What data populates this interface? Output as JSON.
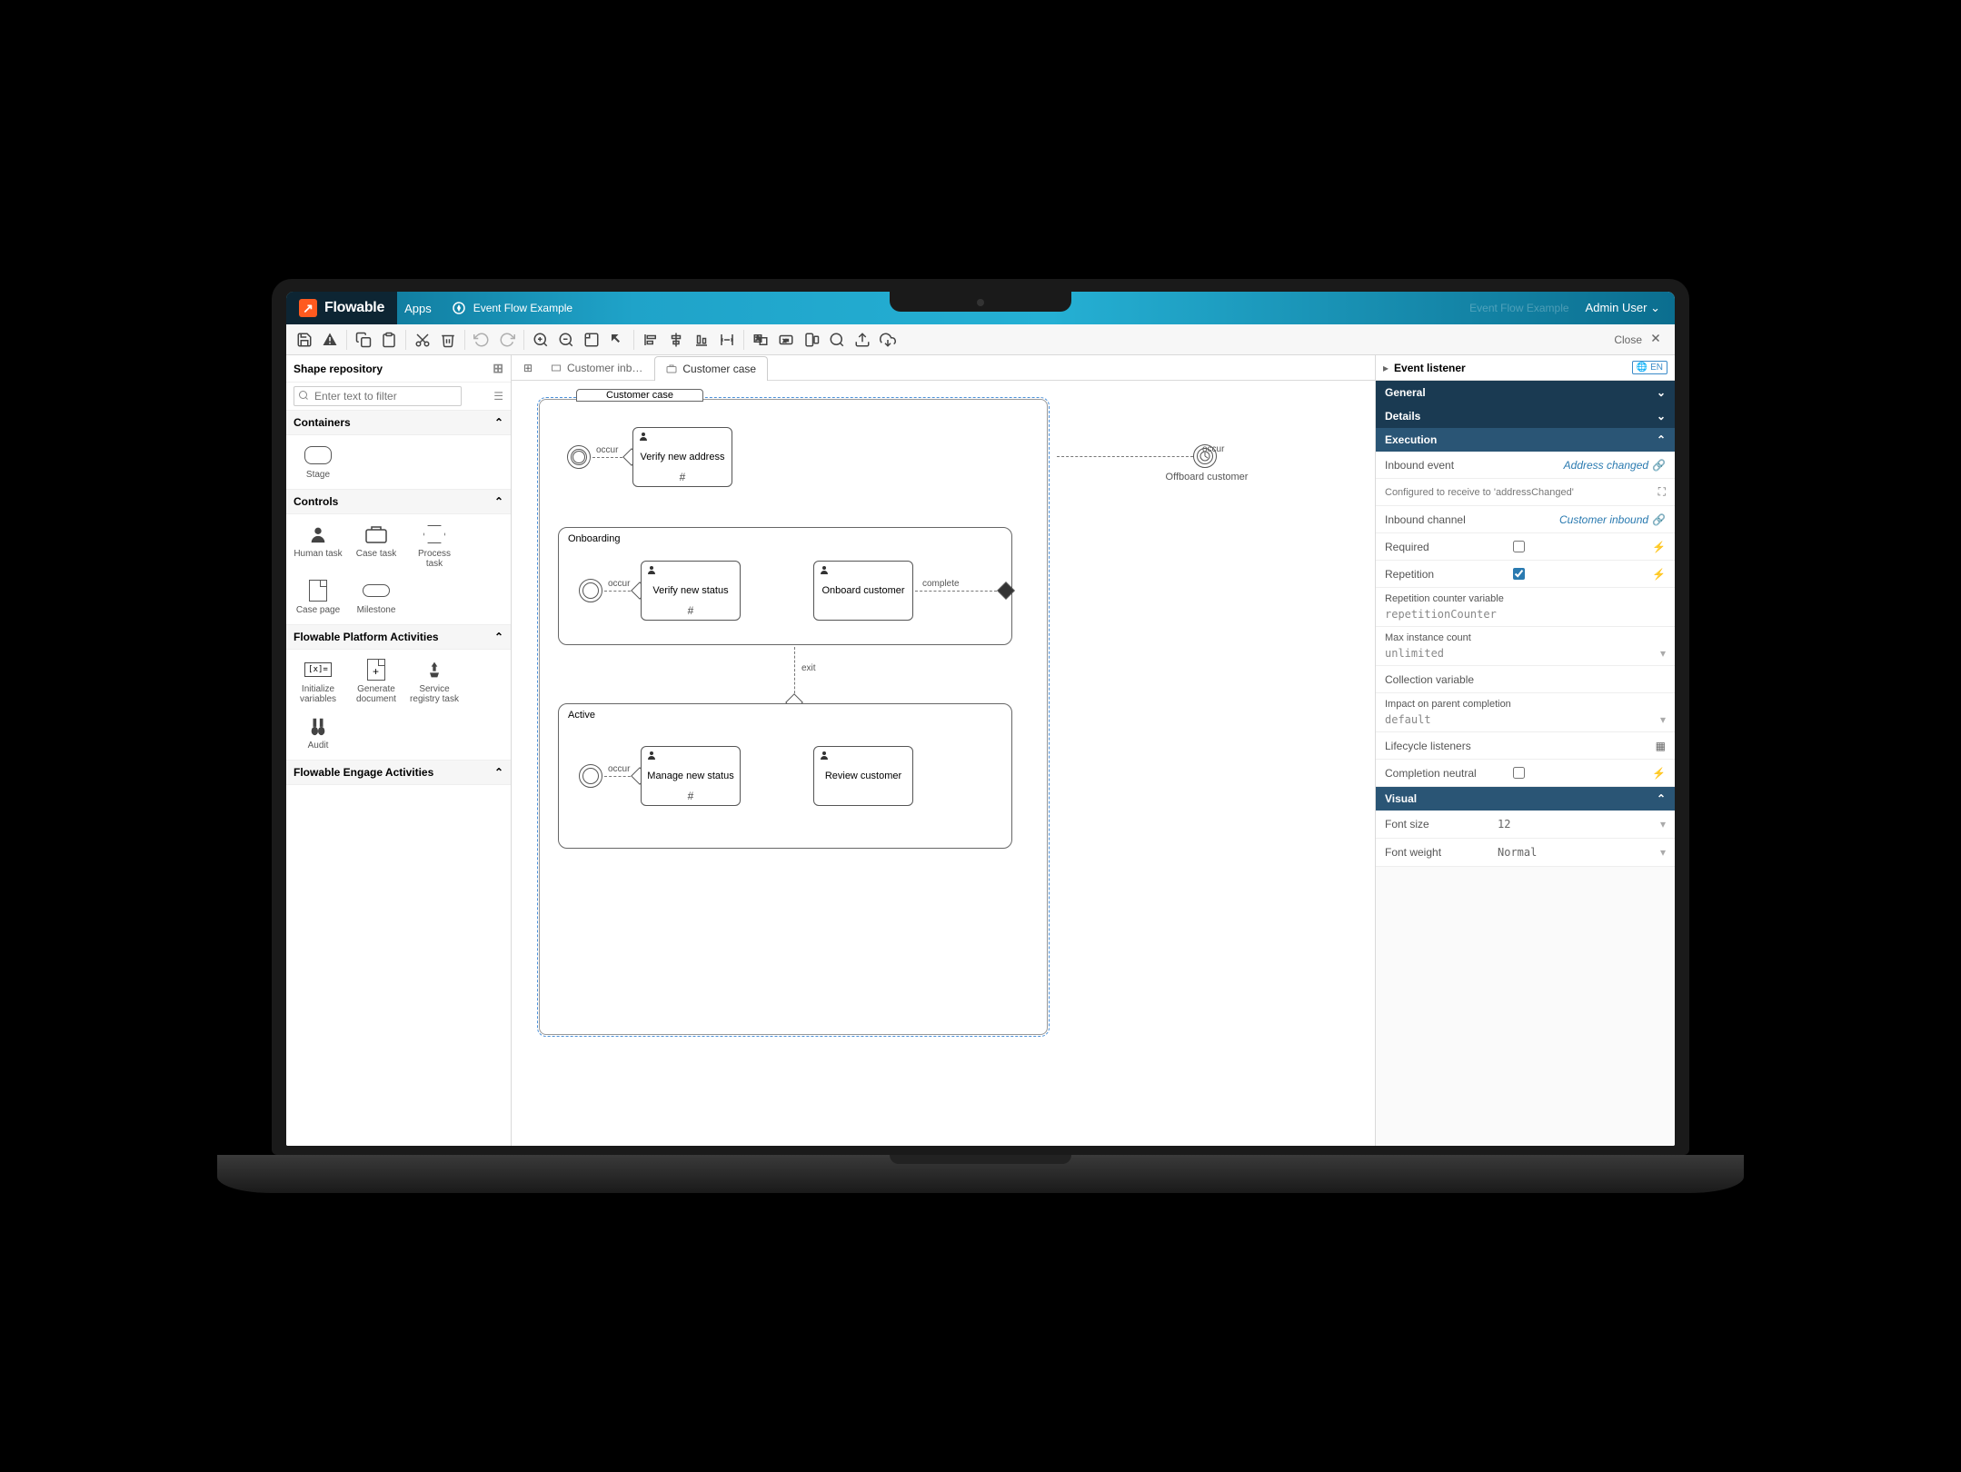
{
  "header": {
    "brand_text": "Flowable",
    "apps_link": "Apps",
    "model_title": "Event Flow Example",
    "breadcrumb_hint": "Event Flow Example",
    "user_label": "Admin User"
  },
  "toolbar": {
    "close_label": "Close"
  },
  "palette": {
    "title": "Shape repository",
    "filter_placeholder": "Enter text to filter",
    "sections": {
      "containers": {
        "title": "Containers",
        "items": [
          {
            "label": "Stage"
          }
        ]
      },
      "controls": {
        "title": "Controls",
        "items": [
          {
            "label": "Human task"
          },
          {
            "label": "Case task"
          },
          {
            "label": "Process task"
          },
          {
            "label": "Case page"
          },
          {
            "label": "Milestone"
          }
        ]
      },
      "platform": {
        "title": "Flowable Platform Activities",
        "items": [
          {
            "label": "Initialize variables"
          },
          {
            "label": "Generate document"
          },
          {
            "label": "Service registry task"
          },
          {
            "label": "Audit"
          }
        ]
      },
      "engage": {
        "title": "Flowable Engage Activities"
      }
    }
  },
  "canvas": {
    "tabs": [
      {
        "label": "Customer inb…",
        "active": false
      },
      {
        "label": "Customer case",
        "active": true
      }
    ],
    "case_title": "Customer case",
    "stages": {
      "onboarding": "Onboarding",
      "active": "Active"
    },
    "tasks": {
      "verify_new_address": "Verify new address",
      "verify_new_status": "Verify new status",
      "onboard_customer": "Onboard customer",
      "manage_new_status": "Manage new status",
      "review_customer": "Review customer"
    },
    "labels": {
      "occur": "occur",
      "complete": "complete",
      "exit": "exit",
      "offboard_customer": "Offboard customer"
    }
  },
  "properties": {
    "element_name": "Event listener",
    "lang_badge": "EN",
    "sections": {
      "general": "General",
      "details": "Details",
      "execution": "Execution",
      "visual": "Visual"
    },
    "execution_rows": {
      "inbound_event": {
        "label": "Inbound event",
        "value": "Address changed"
      },
      "configured": {
        "label": "Configured to receive to 'addressChanged'"
      },
      "inbound_channel": {
        "label": "Inbound channel",
        "value": "Customer inbound"
      },
      "required": {
        "label": "Required",
        "checked": false
      },
      "repetition": {
        "label": "Repetition",
        "checked": true
      },
      "rep_counter": {
        "label": "Repetition counter variable",
        "value": "repetitionCounter"
      },
      "max_instance": {
        "label": "Max instance count",
        "value": "unlimited"
      },
      "collection": {
        "label": "Collection variable",
        "value": ""
      },
      "impact": {
        "label": "Impact on parent completion",
        "value": "default"
      },
      "lifecycle": {
        "label": "Lifecycle listeners"
      },
      "completion_neutral": {
        "label": "Completion neutral",
        "checked": false
      }
    },
    "visual_rows": {
      "font_size": {
        "label": "Font size",
        "value": "12"
      },
      "font_weight": {
        "label": "Font weight",
        "value": "Normal"
      }
    }
  }
}
